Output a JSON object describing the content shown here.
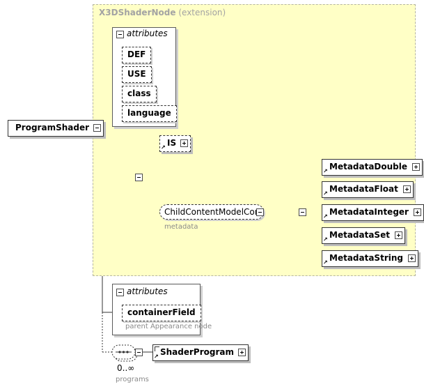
{
  "extension": {
    "name": "X3DShaderNode",
    "label": "(extension)"
  },
  "root": {
    "name": "ProgramShader"
  },
  "attributes_top": {
    "title": "attributes",
    "items": [
      "DEF",
      "USE",
      "class",
      "language"
    ]
  },
  "is_element": {
    "name": "IS"
  },
  "child_content": {
    "name": "ChildContentModelCore",
    "note": "metadata"
  },
  "choice_children": [
    "MetadataDouble",
    "MetadataFloat",
    "MetadataInteger",
    "MetadataSet",
    "MetadataString"
  ],
  "attributes_bottom": {
    "title": "attributes",
    "items": [
      "containerField"
    ],
    "note": "parent Appearance node"
  },
  "programs": {
    "element": "ShaderProgram",
    "cardinality": "0..∞",
    "note": "programs"
  }
}
